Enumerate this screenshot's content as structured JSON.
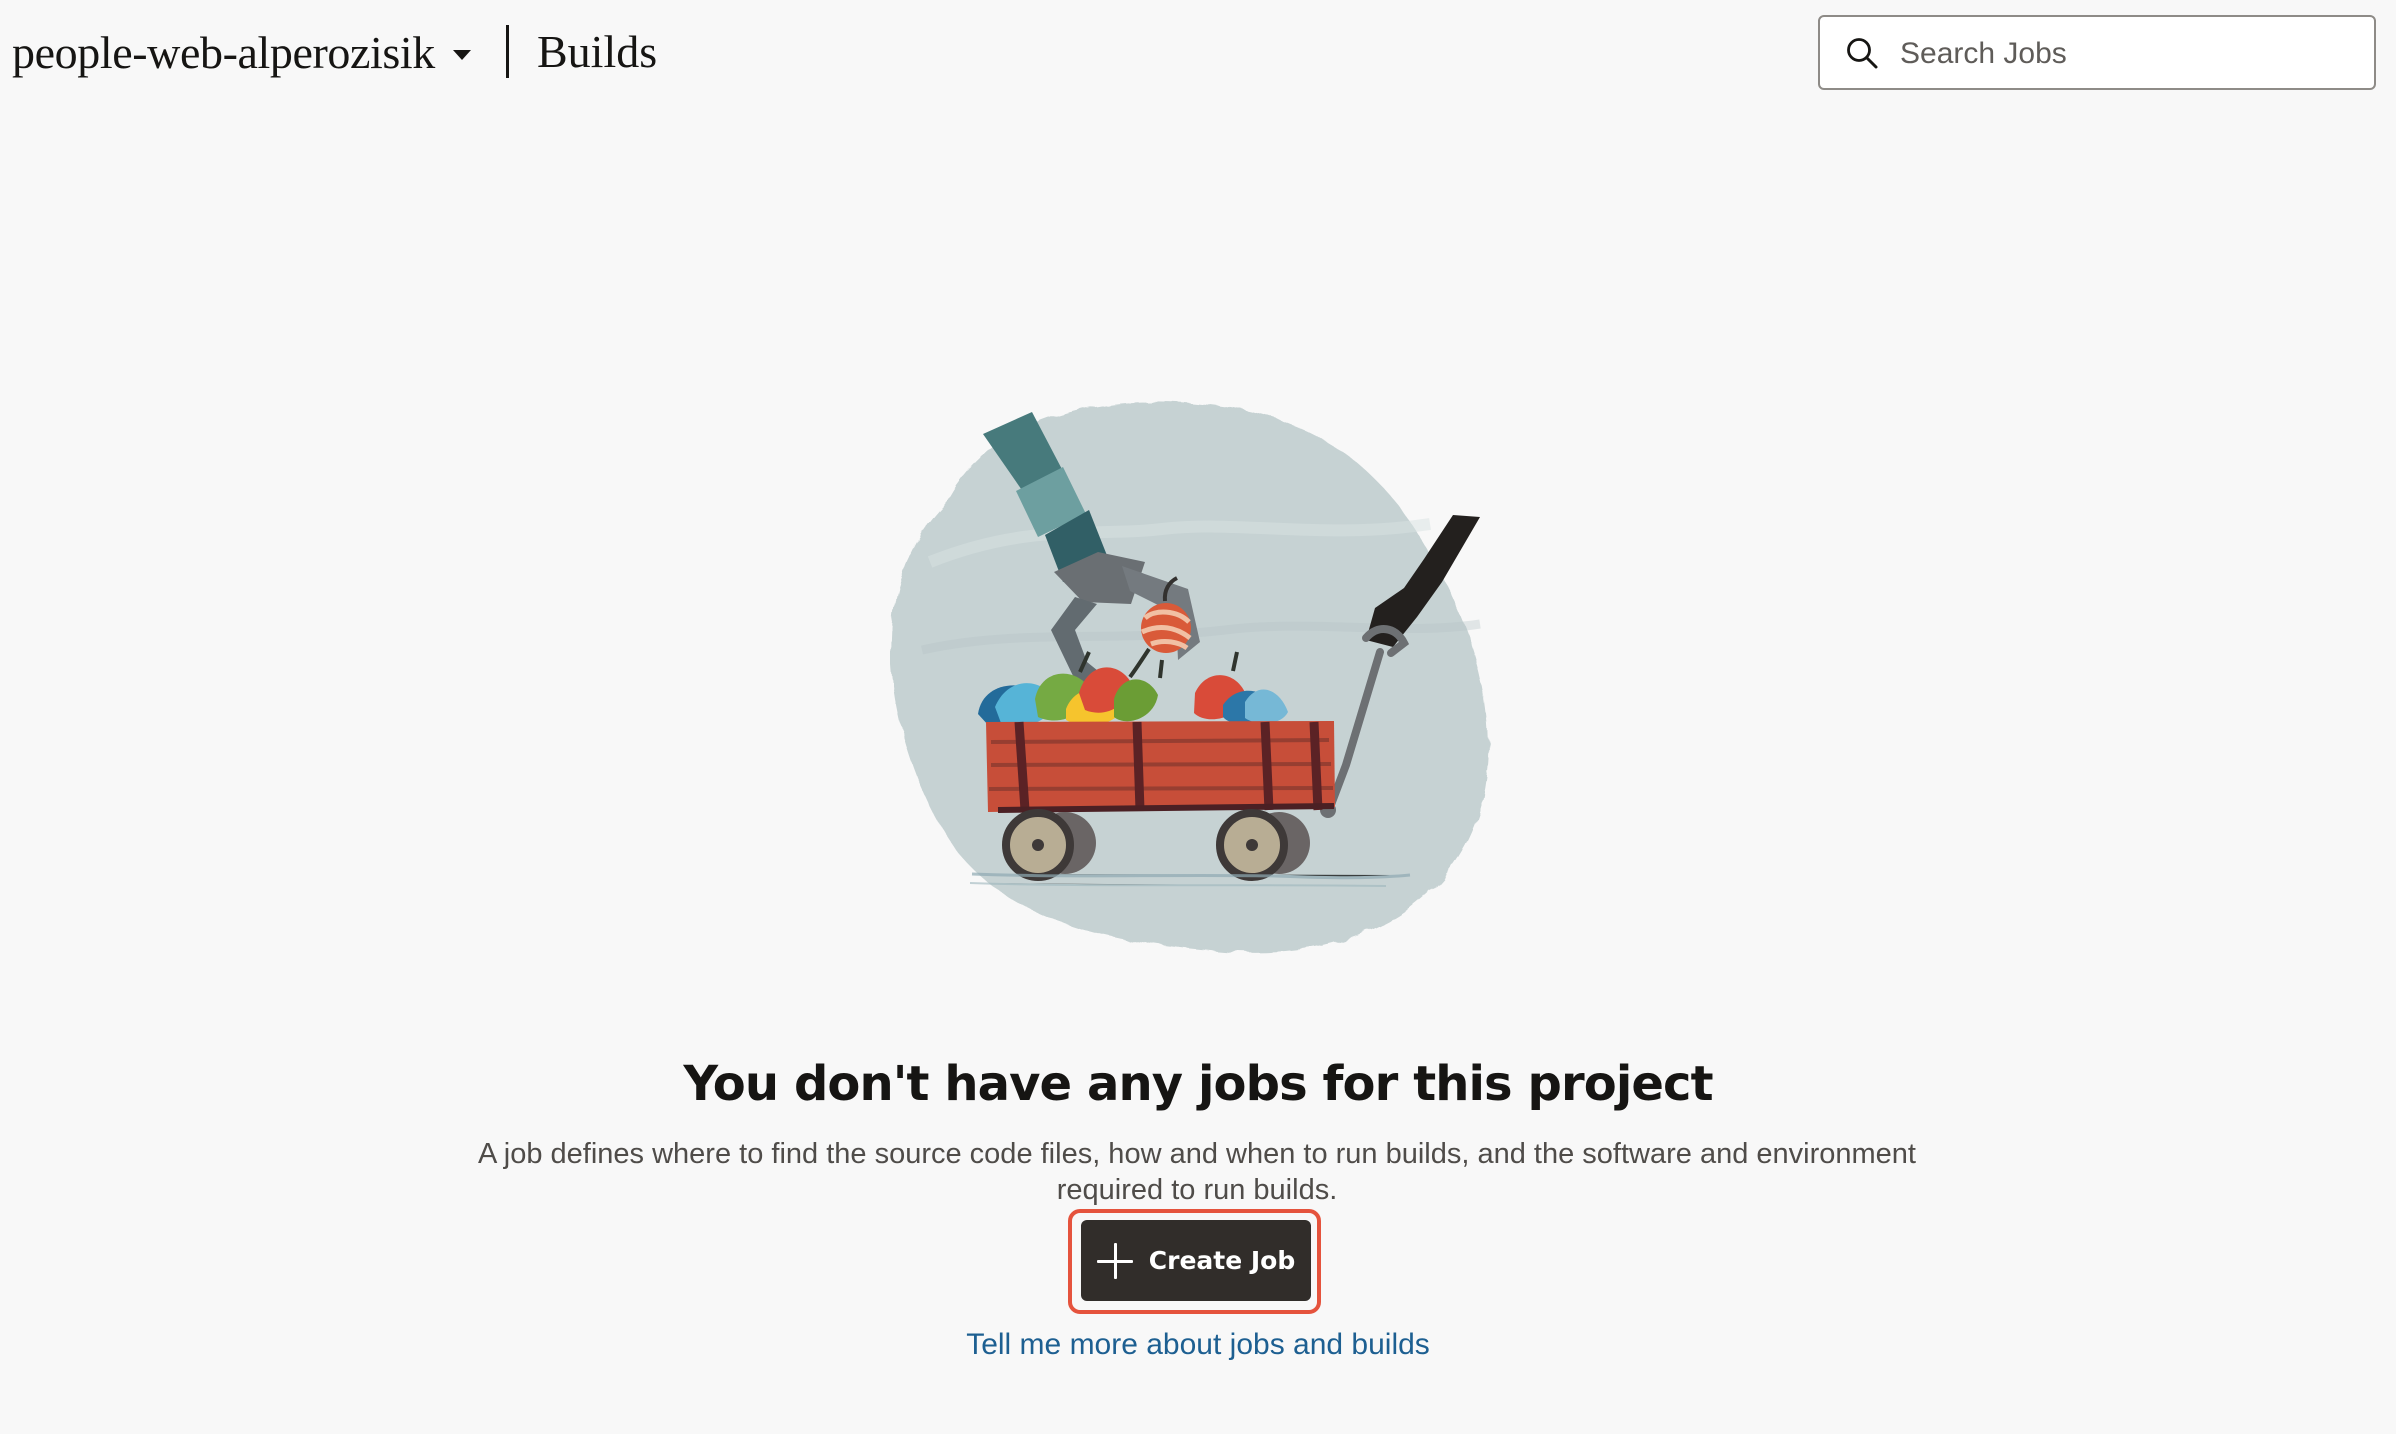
{
  "header": {
    "project_name": "people-web-alperozisik",
    "page_title": "Builds"
  },
  "search": {
    "placeholder": "Search Jobs",
    "value": ""
  },
  "empty_state": {
    "title": "You don't have any jobs for this project",
    "description": "A job defines where to find the source code files, how and when to run builds, and the software and environment required to run builds.",
    "create_job_label": "Create Job",
    "learn_more_label": "Tell me more about jobs and builds"
  },
  "icons": {
    "project_dropdown": "chevron-down-icon",
    "search": "search-icon",
    "create": "plus-icon"
  },
  "colors": {
    "background": "#f8f8f8",
    "primary_button": "#312d2a",
    "focus_ring": "#e5533d",
    "link": "#1d5f91"
  }
}
